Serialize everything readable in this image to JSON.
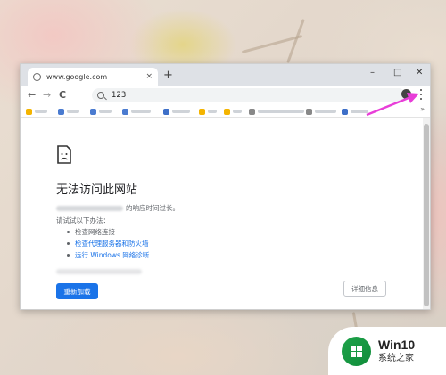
{
  "browser": {
    "tab_title": "www.google.com",
    "tab_close": "×",
    "new_tab": "+",
    "window_controls": {
      "minimize": "–",
      "maximize": "□",
      "close": "✕"
    },
    "nav": {
      "back": "←",
      "forward": "→",
      "reload": "C"
    },
    "omnibox_value": "123",
    "bookmarks_more": "»"
  },
  "error_page": {
    "title": "无法访问此网站",
    "desc_suffix": "的响应时间过长。",
    "try_label": "请试试以下办法：",
    "suggestions": [
      "检查网络连接",
      "检查代理服务器和防火墙",
      "运行 Windows 网络诊断"
    ],
    "reload_button": "重新加载",
    "details_button": "详细信息"
  },
  "badge": {
    "title": "Win10",
    "subtitle": "系统之家"
  },
  "colors": {
    "accent_blue": "#1a73e8",
    "annotation_arrow": "#e83ed8",
    "badge_green": "#1fa34a"
  }
}
